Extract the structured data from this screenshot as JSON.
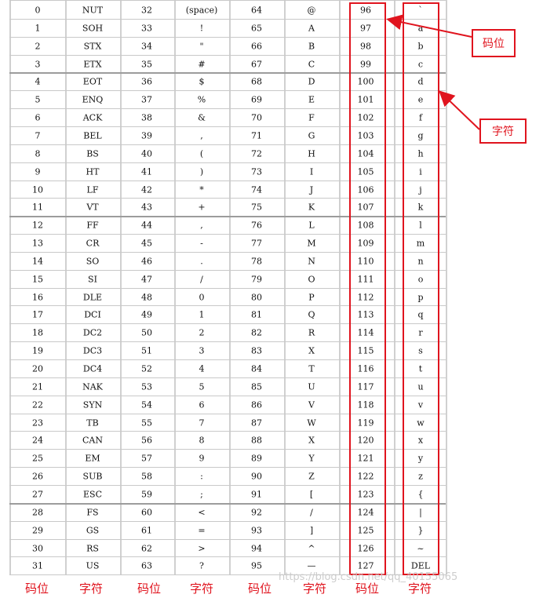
{
  "rows": [
    [
      "0",
      "NUT",
      "32",
      "(space)",
      "64",
      "@",
      "96",
      "`"
    ],
    [
      "1",
      "SOH",
      "33",
      "!",
      "65",
      "A",
      "97",
      "a"
    ],
    [
      "2",
      "STX",
      "34",
      "\"",
      "66",
      "B",
      "98",
      "b"
    ],
    [
      "3",
      "ETX",
      "35",
      "#",
      "67",
      "C",
      "99",
      "c"
    ],
    [
      "4",
      "EOT",
      "36",
      "$",
      "68",
      "D",
      "100",
      "d"
    ],
    [
      "5",
      "ENQ",
      "37",
      "%",
      "69",
      "E",
      "101",
      "e"
    ],
    [
      "6",
      "ACK",
      "38",
      "&",
      "70",
      "F",
      "102",
      "f"
    ],
    [
      "7",
      "BEL",
      "39",
      ",",
      "71",
      "G",
      "103",
      "g"
    ],
    [
      "8",
      "BS",
      "40",
      "(",
      "72",
      "H",
      "104",
      "h"
    ],
    [
      "9",
      "HT",
      "41",
      ")",
      "73",
      "I",
      "105",
      "i"
    ],
    [
      "10",
      "LF",
      "42",
      "*",
      "74",
      "J",
      "106",
      "j"
    ],
    [
      "11",
      "VT",
      "43",
      "+",
      "75",
      "K",
      "107",
      "k"
    ],
    [
      "12",
      "FF",
      "44",
      ",",
      "76",
      "L",
      "108",
      "l"
    ],
    [
      "13",
      "CR",
      "45",
      "-",
      "77",
      "M",
      "109",
      "m"
    ],
    [
      "14",
      "SO",
      "46",
      ".",
      "78",
      "N",
      "110",
      "n"
    ],
    [
      "15",
      "SI",
      "47",
      "/",
      "79",
      "O",
      "111",
      "o"
    ],
    [
      "16",
      "DLE",
      "48",
      "0",
      "80",
      "P",
      "112",
      "p"
    ],
    [
      "17",
      "DCI",
      "49",
      "1",
      "81",
      "Q",
      "113",
      "q"
    ],
    [
      "18",
      "DC2",
      "50",
      "2",
      "82",
      "R",
      "114",
      "r"
    ],
    [
      "19",
      "DC3",
      "51",
      "3",
      "83",
      "X",
      "115",
      "s"
    ],
    [
      "20",
      "DC4",
      "52",
      "4",
      "84",
      "T",
      "116",
      "t"
    ],
    [
      "21",
      "NAK",
      "53",
      "5",
      "85",
      "U",
      "117",
      "u"
    ],
    [
      "22",
      "SYN",
      "54",
      "6",
      "86",
      "V",
      "118",
      "v"
    ],
    [
      "23",
      "TB",
      "55",
      "7",
      "87",
      "W",
      "119",
      "w"
    ],
    [
      "24",
      "CAN",
      "56",
      "8",
      "88",
      "X",
      "120",
      "x"
    ],
    [
      "25",
      "EM",
      "57",
      "9",
      "89",
      "Y",
      "121",
      "y"
    ],
    [
      "26",
      "SUB",
      "58",
      ":",
      "90",
      "Z",
      "122",
      "z"
    ],
    [
      "27",
      "ESC",
      "59",
      ";",
      "91",
      "[",
      "123",
      "{"
    ],
    [
      "28",
      "FS",
      "60",
      "<",
      "92",
      "/",
      "124",
      "|"
    ],
    [
      "29",
      "GS",
      "61",
      "=",
      "93",
      "]",
      "125",
      "}"
    ],
    [
      "30",
      "RS",
      "62",
      ">",
      "94",
      "^",
      "126",
      "~"
    ],
    [
      "31",
      "US",
      "63",
      "?",
      "95",
      "—",
      "127",
      "DEL"
    ]
  ],
  "callouts": {
    "code_point": "码位",
    "character": "字符"
  },
  "footer": [
    "码位",
    "字符",
    "码位",
    "字符",
    "码位",
    "字符",
    "码位",
    "字符"
  ],
  "watermark": "https://blog.csdn.net/qq_40155065",
  "colors": {
    "annotation": "#e0141e",
    "grid": "#c9c9c9"
  }
}
